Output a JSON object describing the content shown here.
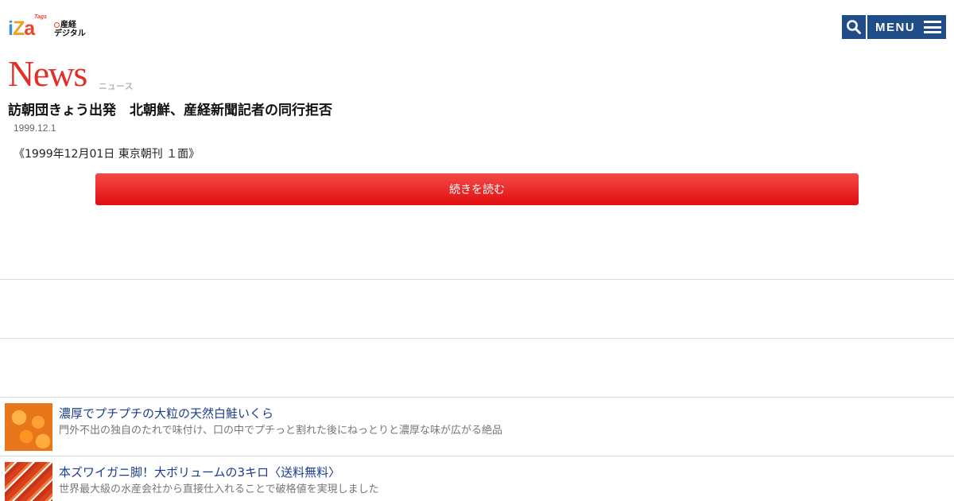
{
  "header": {
    "logo": {
      "iza_i": "i",
      "iza_z": "Z",
      "iza_a": "a",
      "tags": "Tags",
      "sankei_line1": "産経",
      "sankei_line2": "デジタル"
    },
    "search_icon": "search-icon",
    "menu_label": "MENU",
    "menu_icon": "hamburger-icon",
    "button_color": "#1f4d8a"
  },
  "section": {
    "title": "News",
    "subtitle": "ニュース",
    "title_color": "#e0302c"
  },
  "article": {
    "title": "訪朝団きょう出発　北朝鮮、産経新聞記者の同行拒否",
    "date": "1999.12.1",
    "body": "《1999年12月01日 東京朝刊 １面》",
    "read_more": "続きを読む",
    "read_more_color": "#e00d0d"
  },
  "promos": [
    {
      "title": "濃厚でプチプチの大粒の天然白鮭いくら",
      "description": "門外不出の独自のたれで味付け、口の中でプチっと割れた後にねっとりと濃厚な味が広がる絶品"
    },
    {
      "title": "本ズワイガニ脚！大ボリュームの3キロ〈送料無料〉",
      "description": "世界最大級の水産会社から直接仕入れることで破格値を実現しました"
    }
  ]
}
